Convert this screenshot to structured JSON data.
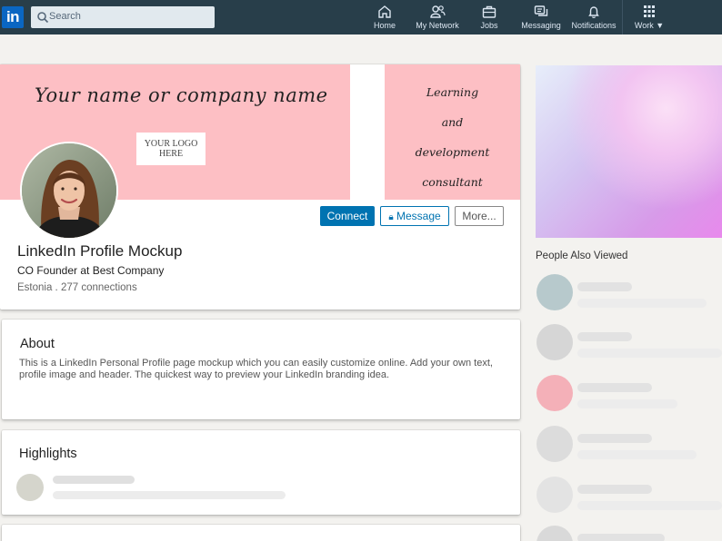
{
  "nav": {
    "search_placeholder": "Search",
    "logo_text": "in",
    "items": [
      {
        "label": "Home",
        "icon": "home-icon"
      },
      {
        "label": "My Network",
        "icon": "my-network-icon"
      },
      {
        "label": "Jobs",
        "icon": "briefcase-icon"
      },
      {
        "label": "Messaging",
        "icon": "messaging-icon"
      },
      {
        "label": "Notifications",
        "icon": "bell-icon"
      },
      {
        "label": "Work",
        "icon": "grid-icon"
      }
    ]
  },
  "colors": {
    "nav_bg": "#283e4a",
    "brand": "#0073b1",
    "banner_pink": "#fdbfc4"
  },
  "banner": {
    "name_text": "Your name or company name",
    "logo_line1": "YOUR LOGO",
    "logo_line2": "HERE",
    "tagline": [
      "Learning",
      "and",
      "development",
      "consultant"
    ]
  },
  "profile": {
    "name": "LinkedIn Profile Mockup",
    "headline": "CO Founder at Best Company",
    "location": "Estonia . 277 connections",
    "buttons": {
      "connect": "Connect",
      "message": "Message",
      "more": "More..."
    }
  },
  "about": {
    "title": "About",
    "text": "This is a LinkedIn Personal Profile page mockup which you can easily customize online. Add your own text, profile image and header. The quickest way to preview your LinkedIn branding idea."
  },
  "highlights": {
    "title": "Highlights"
  },
  "sidebar": {
    "people_also_viewed_title": "People Also Viewed",
    "avatar_colors": [
      "#b7c9cc",
      "#d6d6d6",
      "#f4b0b8",
      "#dcdcdc",
      "#e3e3e3",
      "#d9d9d9"
    ]
  }
}
